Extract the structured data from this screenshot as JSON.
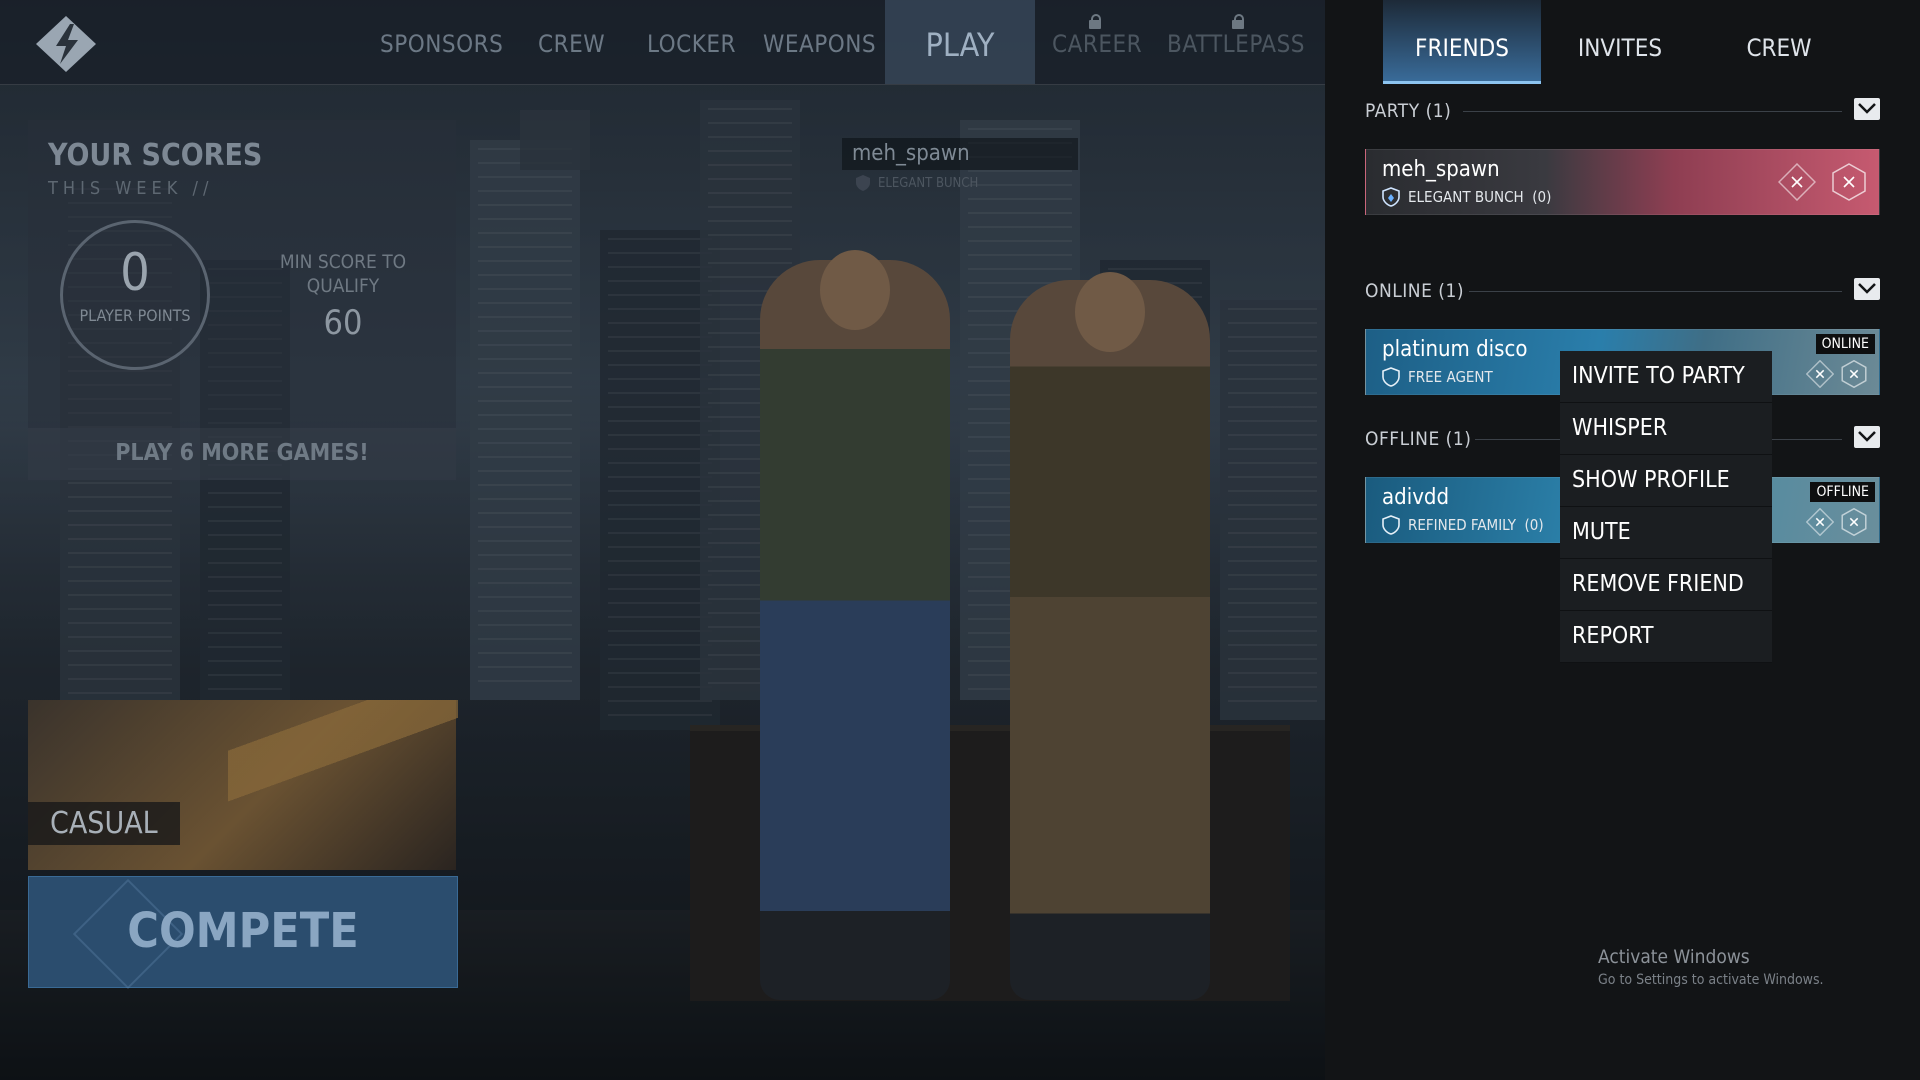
{
  "topnav": {
    "tabs": [
      {
        "label": "SPONSORS",
        "locked": false
      },
      {
        "label": "CREW",
        "locked": false
      },
      {
        "label": "LOCKER",
        "locked": false
      },
      {
        "label": "WEAPONS",
        "locked": false
      },
      {
        "label": "PLAY",
        "locked": false,
        "active": true
      },
      {
        "label": "CAREER",
        "locked": true
      },
      {
        "label": "BATTLEPASS",
        "locked": true
      }
    ]
  },
  "scores": {
    "title": "YOUR SCORES",
    "subtitle": "THIS WEEK //",
    "points_value": "0",
    "points_label": "PLAYER POINTS",
    "min_score_label": "MIN SCORE TO QUALIFY",
    "min_score_value": "60",
    "cta": "PLAY 6 MORE GAMES!"
  },
  "modes": {
    "casual": "CASUAL",
    "compete": "COMPETE"
  },
  "scene_nameplate": {
    "name": "meh_spawn",
    "crew": "ELEGANT BUNCH"
  },
  "friends_panel": {
    "tabs": [
      "FRIENDS",
      "INVITES",
      "CREW"
    ],
    "active_tab": "FRIENDS",
    "sections": {
      "party": {
        "title": "PARTY (1)",
        "members": [
          {
            "name": "meh_spawn",
            "crew": "ELEGANT BUNCH",
            "count": "(0)"
          }
        ]
      },
      "online": {
        "title": "ONLINE (1)",
        "members": [
          {
            "name": "platinum disco",
            "crew": "FREE AGENT",
            "status": "ONLINE"
          }
        ]
      },
      "offline": {
        "title": "OFFLINE (1)",
        "members": [
          {
            "name": "adivdd",
            "crew": "REFINED FAMILY",
            "count": "(0)",
            "status": "OFFLINE"
          }
        ]
      }
    },
    "context_menu": [
      "INVITE TO PARTY",
      "WHISPER",
      "SHOW PROFILE",
      "MUTE",
      "REMOVE FRIEND",
      "REPORT"
    ]
  },
  "watermark": {
    "title": "Activate Windows",
    "subtitle": "Go to Settings to activate Windows."
  },
  "colors": {
    "accent_blue": "#3a6d9c",
    "panel_bg": "#121416",
    "party_card": "#b8485c",
    "online_card": "#1f6f9a"
  }
}
